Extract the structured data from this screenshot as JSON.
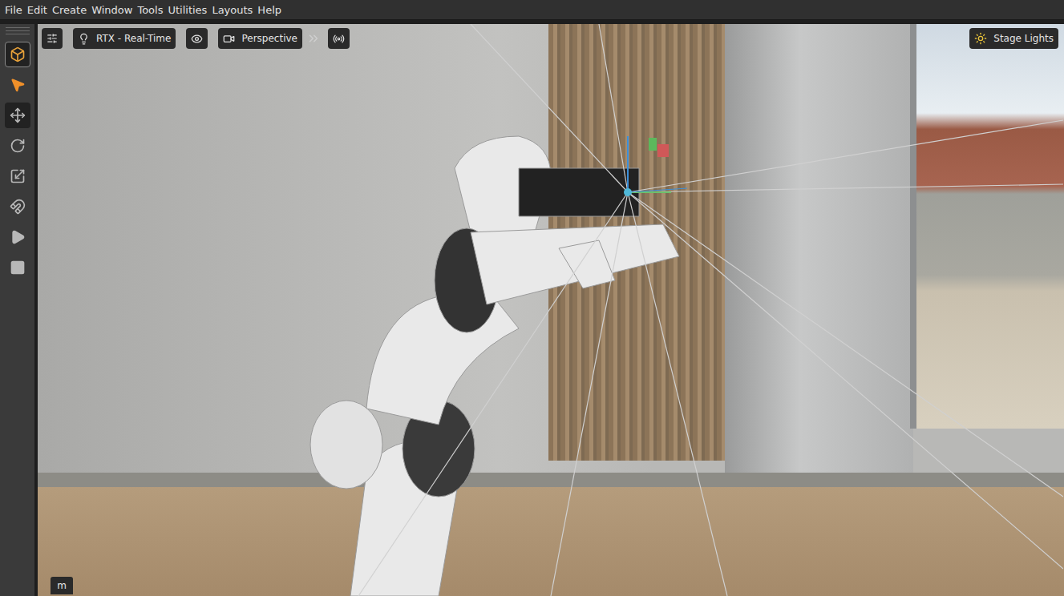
{
  "menu_bar": {
    "items": [
      "File",
      "Edit",
      "Create",
      "Window",
      "Tools",
      "Utilities",
      "Layouts",
      "Help"
    ]
  },
  "toolbar": {
    "tools": [
      {
        "kind": "mode",
        "selected": true
      },
      {
        "kind": "select",
        "selected": true
      },
      {
        "kind": "move",
        "selected": true
      },
      {
        "kind": "rotate",
        "selected": false
      },
      {
        "kind": "scale",
        "selected": false
      },
      {
        "kind": "snap",
        "selected": false
      },
      {
        "kind": "play",
        "selected": false
      },
      {
        "kind": "stop",
        "selected": false
      }
    ]
  },
  "viewport": {
    "renderer": "RTX - Real-Time",
    "camera": "Perspective",
    "lights": "Stage Lights",
    "units": "m"
  }
}
